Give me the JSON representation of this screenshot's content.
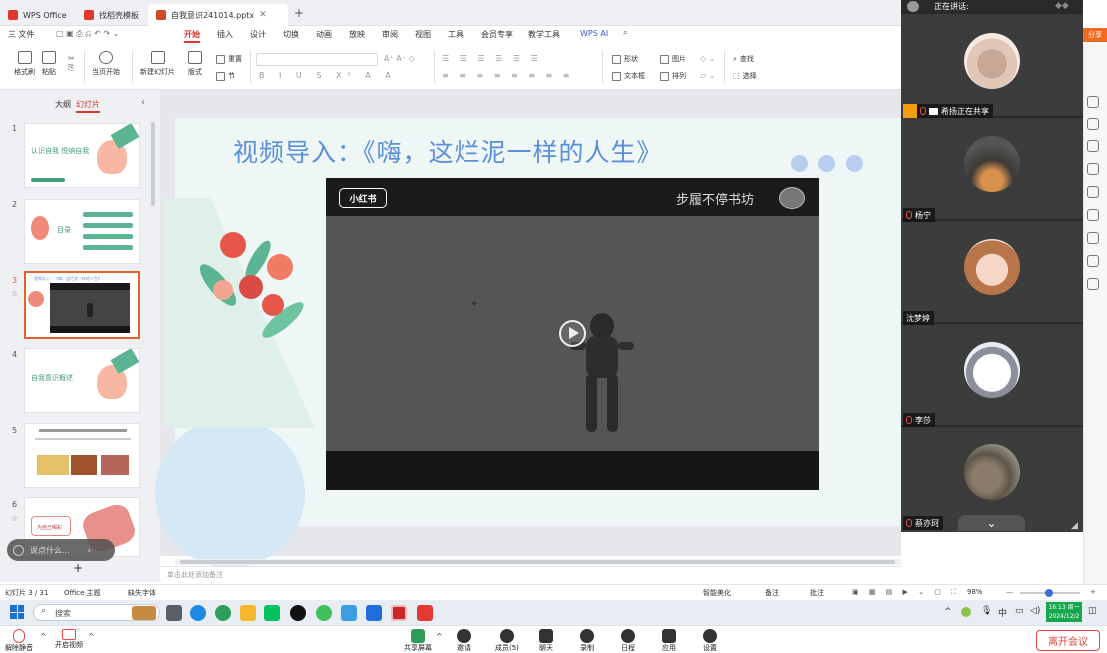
{
  "tabs": [
    {
      "label": "WPS Office",
      "color": "#e3372d"
    },
    {
      "label": "找稻壳模板",
      "color": "#e3372d"
    },
    {
      "label": "自我意识241014.pptx",
      "color": "#d24726"
    }
  ],
  "menu": [
    "三 文件",
    "开始",
    "插入",
    "设计",
    "切换",
    "动画",
    "放映",
    "审阅",
    "视图",
    "工具",
    "会员专享",
    "教学工具",
    "WPS AI"
  ],
  "ribbon": {
    "format_painter": "格式刷",
    "paste": "粘贴",
    "play_from_current": "当页开始",
    "new_slide": "新建幻灯片",
    "layout": "版式",
    "section": "节",
    "reset": "重置",
    "shape": "形状",
    "picture": "图片",
    "textbox": "文本框",
    "arrange": "排列",
    "find": "查找",
    "select": "选择"
  },
  "panel": {
    "tab_outline": "大纲",
    "tab_slides": "幻灯片",
    "slide_numbers": [
      "1",
      "2",
      "3",
      "4",
      "5",
      "6"
    ],
    "thumb1_title": "认识自我 悦纳自我",
    "thumb2_title": "目录",
    "thumb4_title": "自我意识概述",
    "thumb6_title": "为自己喝彩"
  },
  "slide": {
    "title": "视频导入：《嗨，这烂泥一样的人生》",
    "video_badge": "小红书",
    "video_channel": "步履不停书坊"
  },
  "notes_placeholder": "单击此处添加备注",
  "status": {
    "slide_index": "幻灯片 3 / 31",
    "theme": "Office 主题",
    "missing_font": "缺失字体",
    "smart_beautify": "智能美化",
    "notes": "备注",
    "comments": "批注",
    "zoom": "98%"
  },
  "chat_placeholder": "说点什么...",
  "taskbar": {
    "search": "搜索",
    "ime": "中",
    "time": "16:13 周一",
    "date": "2024/12/2"
  },
  "meeting": {
    "header": "正在讲话:",
    "presenter_share": "希扬正在共享",
    "participants": [
      "杨宁",
      "沈梦婷",
      "李莎",
      "蔡亦珂"
    ],
    "toolbar": [
      "解除静音",
      "开启视频",
      "共享屏幕",
      "邀请",
      "成员(5)",
      "聊天",
      "录制",
      "日程",
      "应用",
      "设置"
    ],
    "leave": "离开会议",
    "share_tag": "分享"
  },
  "colors": {
    "wps_red": "#d8392d",
    "slide_title": "#5b8fd8",
    "leave_red": "#e2453c",
    "share_orange": "#f36b21"
  }
}
